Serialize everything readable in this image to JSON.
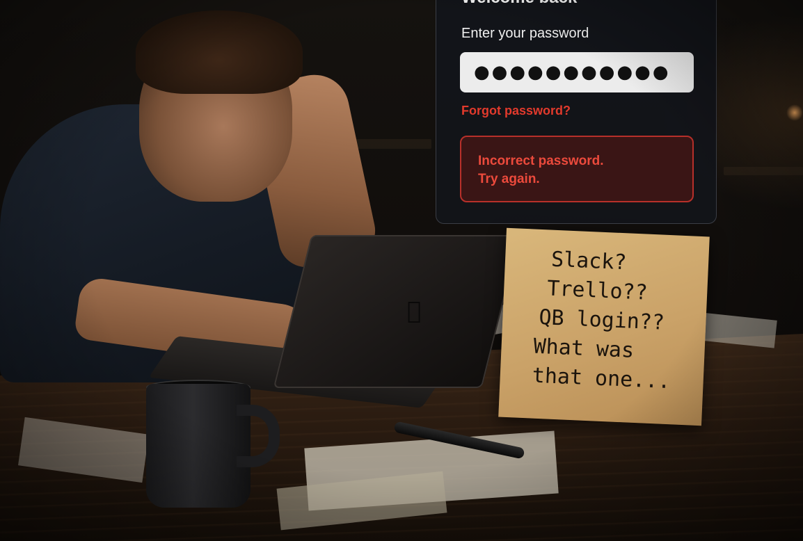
{
  "login": {
    "title": "Welcome back",
    "password_label": "Enter your password",
    "password_value": "●●●●●●●●●●●",
    "forgot_link": "Forgot password?",
    "error_line1": "Incorrect password.",
    "error_line2": "Try again."
  },
  "sticky_note": {
    "lines": [
      "Slack?",
      "Trello??",
      "QB login??",
      "What was",
      "that one..."
    ]
  },
  "colors": {
    "error_red": "#e23a2c",
    "card_background": "#12141a",
    "sticky_note": "#d2ad70"
  },
  "icons": {
    "laptop_logo": "apple-logo-icon"
  }
}
